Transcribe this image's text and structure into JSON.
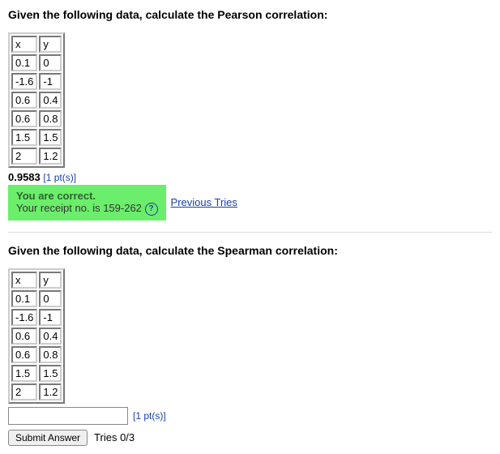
{
  "q1": {
    "prompt": "Given the following data, calculate the Pearson correlation:",
    "headers": {
      "x": "x",
      "y": "y"
    },
    "rows": [
      {
        "x": "0.1",
        "y": "0"
      },
      {
        "x": "-1.6",
        "y": "-1"
      },
      {
        "x": "0.6",
        "y": "0.4"
      },
      {
        "x": "0.6",
        "y": "0.8"
      },
      {
        "x": "1.5",
        "y": "1.5"
      },
      {
        "x": "2",
        "y": "1.2"
      }
    ],
    "answer": "0.9583",
    "points": "[1 pt(s)]",
    "feedback_correct": "You are correct.",
    "feedback_receipt": "Your receipt no. is 159-262",
    "help_glyph": "?",
    "prev_tries": "Previous Tries"
  },
  "q2": {
    "prompt": "Given the following data, calculate the Spearman correlation:",
    "headers": {
      "x": "x",
      "y": "y"
    },
    "rows": [
      {
        "x": "0.1",
        "y": "0"
      },
      {
        "x": "-1.6",
        "y": "-1"
      },
      {
        "x": "0.6",
        "y": "0.4"
      },
      {
        "x": "0.6",
        "y": "0.8"
      },
      {
        "x": "1.5",
        "y": "1.5"
      },
      {
        "x": "2",
        "y": "1.2"
      }
    ],
    "points": "[1 pt(s)]",
    "submit": "Submit Answer",
    "tries": "Tries 0/3"
  }
}
